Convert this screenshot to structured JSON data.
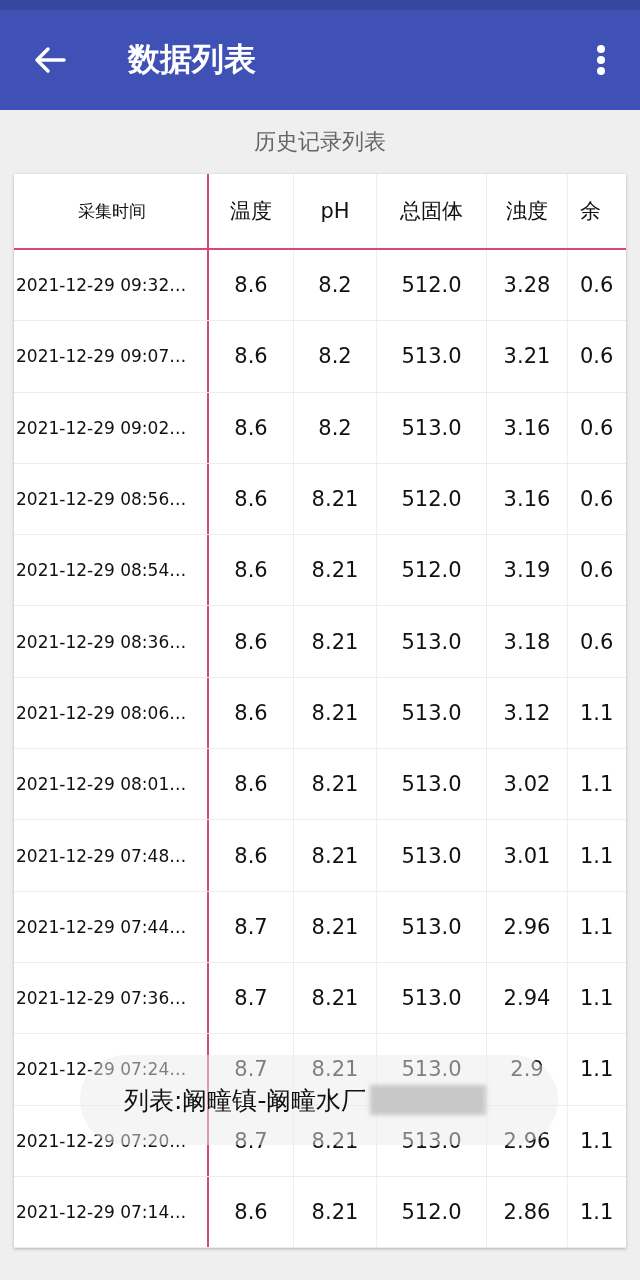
{
  "app_bar": {
    "title": "数据列表"
  },
  "subtitle": "历史记录列表",
  "table": {
    "columns": [
      "采集时间",
      "温度",
      "pH",
      "总固体",
      "浊度",
      "余"
    ],
    "rows": [
      [
        "2021-12-29 09:32…",
        "8.6",
        "8.2",
        "512.0",
        "3.28",
        "0.6"
      ],
      [
        "2021-12-29 09:07…",
        "8.6",
        "8.2",
        "513.0",
        "3.21",
        "0.6"
      ],
      [
        "2021-12-29 09:02…",
        "8.6",
        "8.2",
        "513.0",
        "3.16",
        "0.6"
      ],
      [
        "2021-12-29 08:56…",
        "8.6",
        "8.21",
        "512.0",
        "3.16",
        "0.6"
      ],
      [
        "2021-12-29 08:54…",
        "8.6",
        "8.21",
        "512.0",
        "3.19",
        "0.6"
      ],
      [
        "2021-12-29 08:36…",
        "8.6",
        "8.21",
        "513.0",
        "3.18",
        "0.6"
      ],
      [
        "2021-12-29 08:06…",
        "8.6",
        "8.21",
        "513.0",
        "3.12",
        "1.1"
      ],
      [
        "2021-12-29 08:01…",
        "8.6",
        "8.21",
        "513.0",
        "3.02",
        "1.1"
      ],
      [
        "2021-12-29 07:48…",
        "8.6",
        "8.21",
        "513.0",
        "3.01",
        "1.1"
      ],
      [
        "2021-12-29 07:44…",
        "8.7",
        "8.21",
        "513.0",
        "2.96",
        "1.1"
      ],
      [
        "2021-12-29 07:36…",
        "8.7",
        "8.21",
        "513.0",
        "2.94",
        "1.1"
      ],
      [
        "2021-12-29 07:24…",
        "8.7",
        "8.21",
        "513.0",
        "2.9",
        "1.1"
      ],
      [
        "2021-12-29 07:20…",
        "8.7",
        "8.21",
        "513.0",
        "2.96",
        "1.1"
      ],
      [
        "2021-12-29 07:14…",
        "8.6",
        "8.21",
        "512.0",
        "2.86",
        "1.1"
      ]
    ]
  },
  "toast": {
    "text": "列表:阚疃镇-阚疃水厂"
  }
}
